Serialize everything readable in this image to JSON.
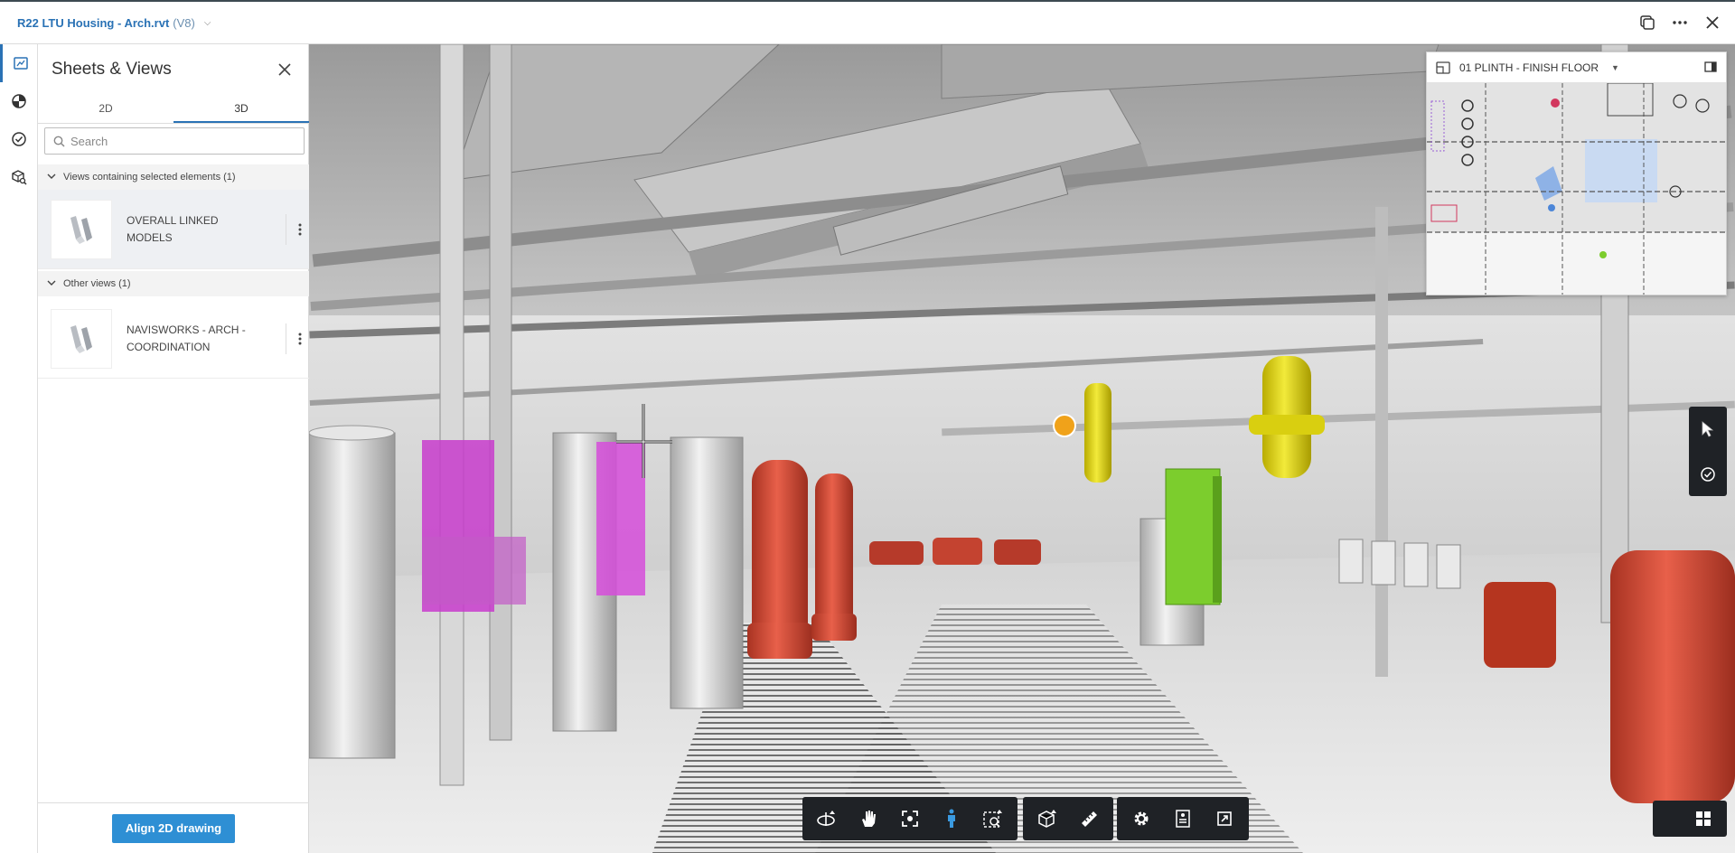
{
  "topbar": {
    "title": "R22 LTU Housing - Arch.rvt",
    "version": "(V8)"
  },
  "panel": {
    "title": "Sheets & Views",
    "tabs": [
      {
        "label": "2D",
        "active": false
      },
      {
        "label": "3D",
        "active": true
      }
    ],
    "search_placeholder": "Search",
    "sections": [
      {
        "label": "Views containing selected elements (1)",
        "items": [
          {
            "label": "OVERALL LINKED MODELS",
            "selected": true
          }
        ]
      },
      {
        "label": "Other views (1)",
        "items": [
          {
            "label": "NAVISWORKS - ARCH - COORDINATION",
            "selected": false
          }
        ]
      }
    ],
    "footer_button": "Align 2D drawing"
  },
  "minimap": {
    "title": "01 PLINTH - FINISH FLOOR"
  },
  "colors": {
    "accent": "#2a72b5",
    "button": "#2e8fd4",
    "toolbar": "#1f2226",
    "pipe_red": "#d9543e",
    "pipe_yellow": "#e6dc1e",
    "equipment_green": "#7ccd2d",
    "duct_magenta": "#d23fd6",
    "marker_orange": "#f0a21a"
  },
  "icons": {
    "toolbar": [
      "orbit-icon",
      "pan-icon",
      "fit-to-view-icon",
      "first-person-icon",
      "zoom-window-icon",
      "section-box-icon",
      "measure-icon",
      "settings-icon",
      "properties-icon",
      "fullscreen-icon"
    ],
    "vtools": [
      "select-cursor-icon",
      "markup-check-icon"
    ]
  }
}
